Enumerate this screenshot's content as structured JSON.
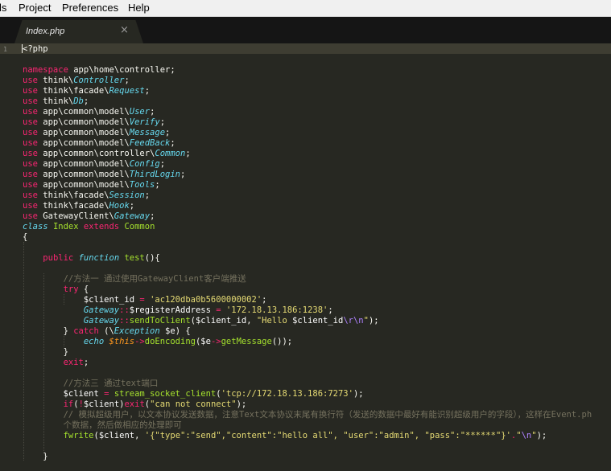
{
  "menu": {
    "items": [
      "ls",
      "Project",
      "Preferences",
      "Help"
    ]
  },
  "tab": {
    "title": "Index.php",
    "close_glyph": "×"
  },
  "editor": {
    "gutter_numbers": [
      "1",
      "",
      "",
      "",
      "",
      "",
      "",
      "",
      "",
      "",
      "",
      "",
      "",
      "",
      "",
      "",
      "",
      "",
      "",
      "",
      "",
      "",
      "",
      "",
      "",
      "",
      "",
      "",
      "",
      "",
      "",
      "",
      "",
      "",
      "",
      "",
      "",
      "",
      "",
      "",
      ""
    ],
    "lines": [
      [
        [
          "p",
          "<?php"
        ]
      ],
      [],
      [
        [
          "k",
          "namespace"
        ],
        [
          "p",
          " app\\home\\controller;"
        ]
      ],
      [
        [
          "k",
          "use"
        ],
        [
          "p",
          " think\\"
        ],
        [
          "ic",
          "Controller"
        ],
        [
          "p",
          ";"
        ]
      ],
      [
        [
          "k",
          "use"
        ],
        [
          "p",
          " think\\facade\\"
        ],
        [
          "ic",
          "Request"
        ],
        [
          "p",
          ";"
        ]
      ],
      [
        [
          "k",
          "use"
        ],
        [
          "p",
          " think\\"
        ],
        [
          "ic",
          "Db"
        ],
        [
          "p",
          ";"
        ]
      ],
      [
        [
          "k",
          "use"
        ],
        [
          "p",
          " app\\common\\model\\"
        ],
        [
          "ic",
          "User"
        ],
        [
          "p",
          ";"
        ]
      ],
      [
        [
          "k",
          "use"
        ],
        [
          "p",
          " app\\common\\model\\"
        ],
        [
          "ic",
          "Verify"
        ],
        [
          "p",
          ";"
        ]
      ],
      [
        [
          "k",
          "use"
        ],
        [
          "p",
          " app\\common\\model\\"
        ],
        [
          "ic",
          "Message"
        ],
        [
          "p",
          ";"
        ]
      ],
      [
        [
          "k",
          "use"
        ],
        [
          "p",
          " app\\common\\model\\"
        ],
        [
          "ic",
          "FeedBack"
        ],
        [
          "p",
          ";"
        ]
      ],
      [
        [
          "k",
          "use"
        ],
        [
          "p",
          " app\\common\\controller\\"
        ],
        [
          "ic",
          "Common"
        ],
        [
          "p",
          ";"
        ]
      ],
      [
        [
          "k",
          "use"
        ],
        [
          "p",
          " app\\common\\model\\"
        ],
        [
          "ic",
          "Config"
        ],
        [
          "p",
          ";"
        ]
      ],
      [
        [
          "k",
          "use"
        ],
        [
          "p",
          " app\\common\\model\\"
        ],
        [
          "ic",
          "ThirdLogin"
        ],
        [
          "p",
          ";"
        ]
      ],
      [
        [
          "k",
          "use"
        ],
        [
          "p",
          " app\\common\\model\\"
        ],
        [
          "ic",
          "Tools"
        ],
        [
          "p",
          ";"
        ]
      ],
      [
        [
          "k",
          "use"
        ],
        [
          "p",
          " think\\facade\\"
        ],
        [
          "ic",
          "Session"
        ],
        [
          "p",
          ";"
        ]
      ],
      [
        [
          "k",
          "use"
        ],
        [
          "p",
          " think\\facade\\"
        ],
        [
          "ic",
          "Hook"
        ],
        [
          "p",
          ";"
        ]
      ],
      [
        [
          "k",
          "use"
        ],
        [
          "p",
          " GatewayClient\\"
        ],
        [
          "ic",
          "Gateway"
        ],
        [
          "p",
          ";"
        ]
      ],
      [
        [
          "sk",
          "class"
        ],
        [
          "p",
          " "
        ],
        [
          "cl",
          "Index"
        ],
        [
          "p",
          " "
        ],
        [
          "k",
          "extends"
        ],
        [
          "p",
          " "
        ],
        [
          "cl",
          "Common"
        ]
      ],
      [
        [
          "p",
          "{"
        ]
      ],
      [],
      [
        [
          "p",
          "    "
        ],
        [
          "k",
          "public"
        ],
        [
          "p",
          " "
        ],
        [
          "sk",
          "function"
        ],
        [
          "p",
          " "
        ],
        [
          "fn",
          "test"
        ],
        [
          "p",
          "(){"
        ]
      ],
      [],
      [
        [
          "p",
          "        "
        ],
        [
          "c",
          "//方法一 通过使用GatewayClient客户端推送"
        ]
      ],
      [
        [
          "p",
          "        "
        ],
        [
          "k",
          "try"
        ],
        [
          "p",
          " {"
        ]
      ],
      [
        [
          "p",
          "            "
        ],
        [
          "vr",
          "$client_id"
        ],
        [
          "p",
          " "
        ],
        [
          "k",
          "="
        ],
        [
          "p",
          " "
        ],
        [
          "s",
          "'ac120dba0b5600000002'"
        ],
        [
          "p",
          ";"
        ]
      ],
      [
        [
          "p",
          "            "
        ],
        [
          "ic",
          "Gateway"
        ],
        [
          "k",
          "::"
        ],
        [
          "vr",
          "$registerAddress"
        ],
        [
          "p",
          " "
        ],
        [
          "k",
          "="
        ],
        [
          "p",
          " "
        ],
        [
          "s",
          "'172.18.13.186:1238'"
        ],
        [
          "p",
          ";"
        ]
      ],
      [
        [
          "p",
          "            "
        ],
        [
          "ic",
          "Gateway"
        ],
        [
          "k",
          "::"
        ],
        [
          "fn",
          "sendToClient"
        ],
        [
          "p",
          "("
        ],
        [
          "vr",
          "$client_id"
        ],
        [
          "p",
          ", "
        ],
        [
          "s",
          "\"Hello "
        ],
        [
          "vr",
          "$client_id"
        ],
        [
          "esc",
          "\\r\\n"
        ],
        [
          "s",
          "\""
        ],
        [
          "p",
          ");"
        ]
      ],
      [
        [
          "p",
          "        } "
        ],
        [
          "k",
          "catch"
        ],
        [
          "p",
          " (\\"
        ],
        [
          "ic",
          "Exception"
        ],
        [
          "p",
          " "
        ],
        [
          "vr",
          "$e"
        ],
        [
          "p",
          ") {"
        ]
      ],
      [
        [
          "p",
          "            "
        ],
        [
          "sk",
          "echo"
        ],
        [
          "p",
          " "
        ],
        [
          "th",
          "$this"
        ],
        [
          "k",
          "->"
        ],
        [
          "fn",
          "doEncoding"
        ],
        [
          "p",
          "("
        ],
        [
          "vr",
          "$e"
        ],
        [
          "k",
          "->"
        ],
        [
          "fn",
          "getMessage"
        ],
        [
          "p",
          "());"
        ]
      ],
      [
        [
          "p",
          "        }"
        ]
      ],
      [
        [
          "p",
          "        "
        ],
        [
          "k",
          "exit"
        ],
        [
          "p",
          ";"
        ]
      ],
      [],
      [
        [
          "p",
          "        "
        ],
        [
          "c",
          "//方法三 通过text端口"
        ]
      ],
      [
        [
          "p",
          "        "
        ],
        [
          "vr",
          "$client"
        ],
        [
          "p",
          " "
        ],
        [
          "k",
          "="
        ],
        [
          "p",
          " "
        ],
        [
          "fn",
          "stream_socket_client"
        ],
        [
          "p",
          "("
        ],
        [
          "s",
          "'tcp://172.18.13.186:7273'"
        ],
        [
          "p",
          ");"
        ]
      ],
      [
        [
          "p",
          "        "
        ],
        [
          "k",
          "if"
        ],
        [
          "p",
          "("
        ],
        [
          "k",
          "!"
        ],
        [
          "vr",
          "$client"
        ],
        [
          "p",
          ")"
        ],
        [
          "k",
          "exit"
        ],
        [
          "p",
          "("
        ],
        [
          "s",
          "\"can not connect\""
        ],
        [
          "p",
          ");"
        ]
      ],
      [
        [
          "p",
          "        "
        ],
        [
          "c",
          "// 模拟超级用户，以文本协议发送数据，注意Text文本协议末尾有换行符（发送的数据中最好有能识别超级用户的字段），这样在Event.ph"
        ]
      ],
      [
        [
          "p",
          "        "
        ],
        [
          "c",
          "个数据，然后做相应的处理即可"
        ]
      ],
      [
        [
          "p",
          "        "
        ],
        [
          "fn",
          "fwrite"
        ],
        [
          "p",
          "("
        ],
        [
          "vr",
          "$client"
        ],
        [
          "p",
          ", "
        ],
        [
          "s",
          "'{\"type\":\"send\",\"content\":\"hello all\", \"user\":\"admin\", \"pass\":\"******\"}'"
        ],
        [
          "k",
          "."
        ],
        [
          "s",
          "\""
        ],
        [
          "esc",
          "\\n"
        ],
        [
          "s",
          "\""
        ],
        [
          "p",
          ");"
        ]
      ],
      [],
      [
        [
          "p",
          "    }"
        ]
      ],
      []
    ]
  }
}
